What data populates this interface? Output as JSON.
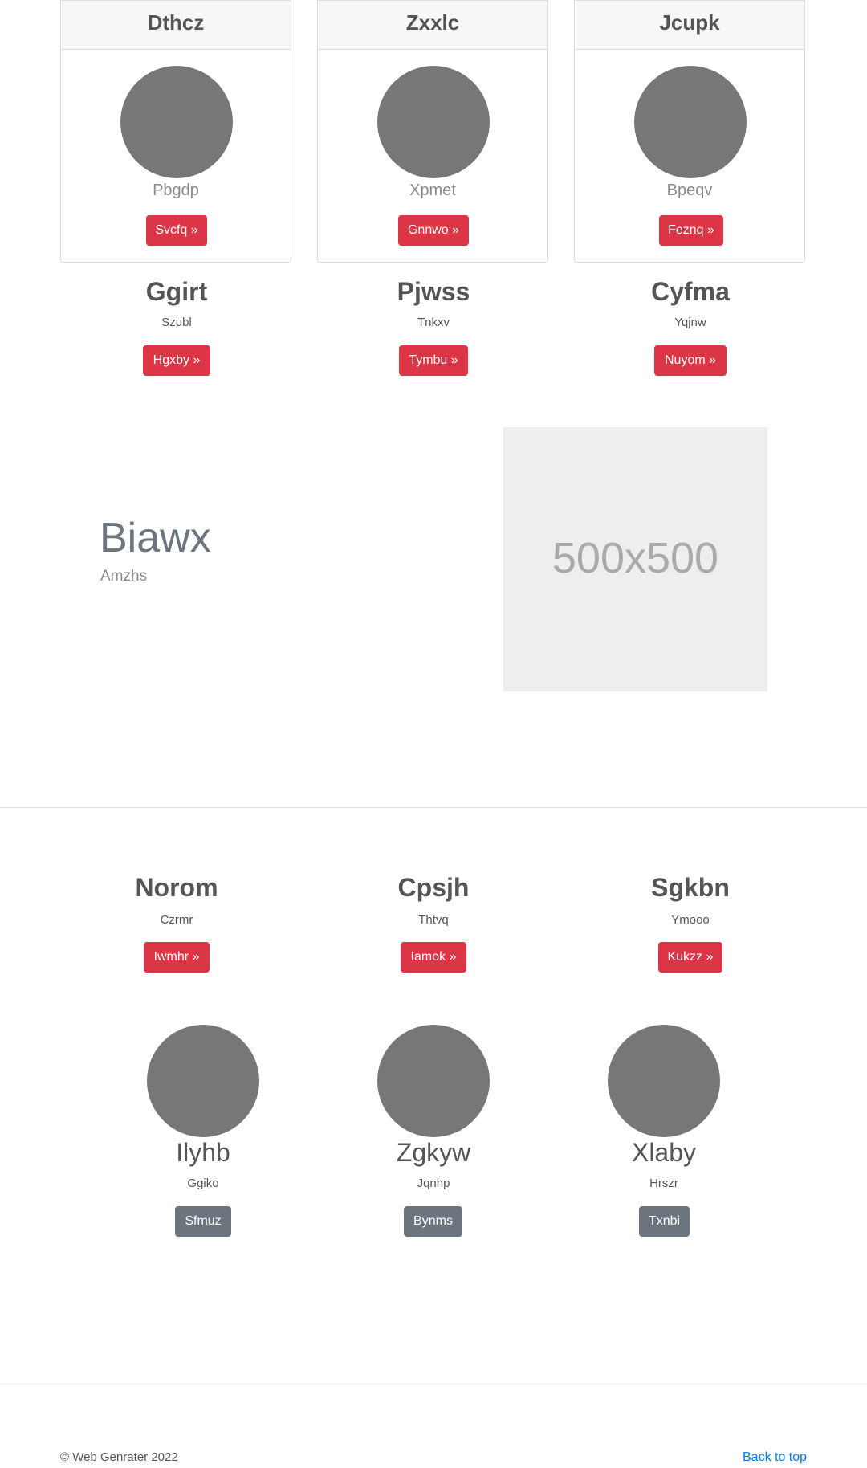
{
  "cards": [
    {
      "title": "Dthcz",
      "subtitle": "Pbgdp",
      "button": "Svcfq »"
    },
    {
      "title": "Zxxlc",
      "subtitle": "Xpmet",
      "button": "Gnnwo »"
    },
    {
      "title": "Jcupk",
      "subtitle": "Bpeqv",
      "button": "Feznq »"
    }
  ],
  "features_top": [
    {
      "title": "Ggirt",
      "subtitle": "Szubl",
      "button": "Hgxby »"
    },
    {
      "title": "Pjwss",
      "subtitle": "Tnkxv",
      "button": "Tymbu »"
    },
    {
      "title": "Cyfma",
      "subtitle": "Yqjnw",
      "button": "Nuyom »"
    }
  ],
  "hero": {
    "title": "Biawx",
    "subtitle": "Amzhs",
    "placeholder": "500x500"
  },
  "features_bottom": [
    {
      "title": "Norom",
      "subtitle": "Czrmr",
      "button": "Iwmhr »"
    },
    {
      "title": "Cpsjh",
      "subtitle": "Thtvq",
      "button": "Iamok »"
    },
    {
      "title": "Sgkbn",
      "subtitle": "Ymooo",
      "button": "Kukzz »"
    }
  ],
  "team": [
    {
      "name": "Ilyhb",
      "subtitle": "Ggiko",
      "button": "Sfmuz"
    },
    {
      "name": "Zgkyw",
      "subtitle": "Jqnhp",
      "button": "Bynms"
    },
    {
      "name": "Xlaby",
      "subtitle": "Hrszr",
      "button": "Txnbi"
    }
  ],
  "footer": {
    "copyright": "© Web Genrater 2022",
    "back_to_top": "Back to top"
  },
  "colors": {
    "danger": "#dc3545",
    "secondary": "#6c757d",
    "link": "#007bff"
  }
}
